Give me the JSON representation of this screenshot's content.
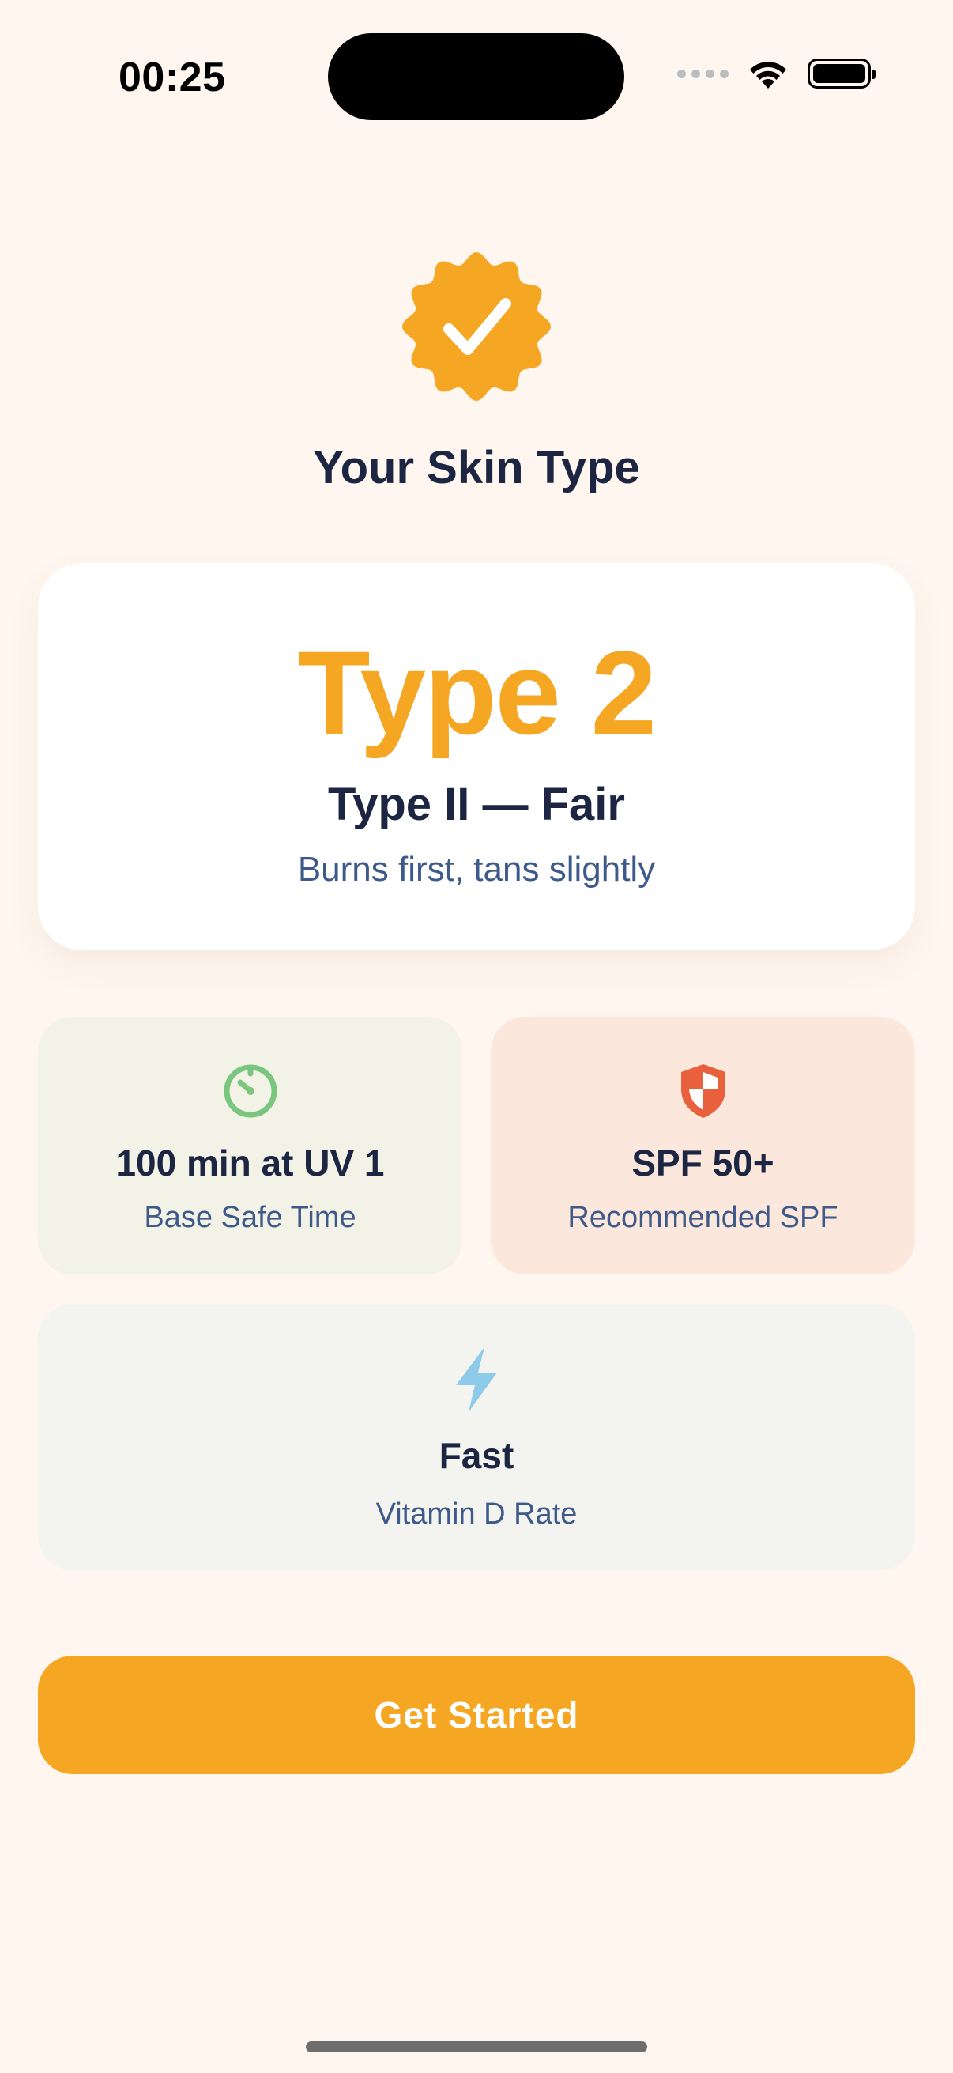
{
  "status_bar": {
    "time": "00:25"
  },
  "header": {
    "badge_icon": "verified-badge-icon",
    "title": "Your Skin Type"
  },
  "type_card": {
    "type_number": "Type 2",
    "type_name": "Type II — Fair",
    "description": "Burns first, tans slightly"
  },
  "tiles": [
    {
      "icon": "timer-icon",
      "value": "100 min at UV 1",
      "label": "Base Safe Time"
    },
    {
      "icon": "shield-icon",
      "value": "SPF 50+",
      "label": "Recommended SPF"
    },
    {
      "icon": "lightning-icon",
      "value": "Fast",
      "label": "Vitamin D Rate"
    }
  ],
  "cta": {
    "label": "Get Started"
  },
  "colors": {
    "background": "#FEF6EF",
    "accent": "#F5A623",
    "heading": "#1C2541",
    "subtext": "#3E5A8A",
    "timer_green": "#7BC67E",
    "shield_red": "#E8613C",
    "bolt_blue": "#8ECBEA"
  }
}
